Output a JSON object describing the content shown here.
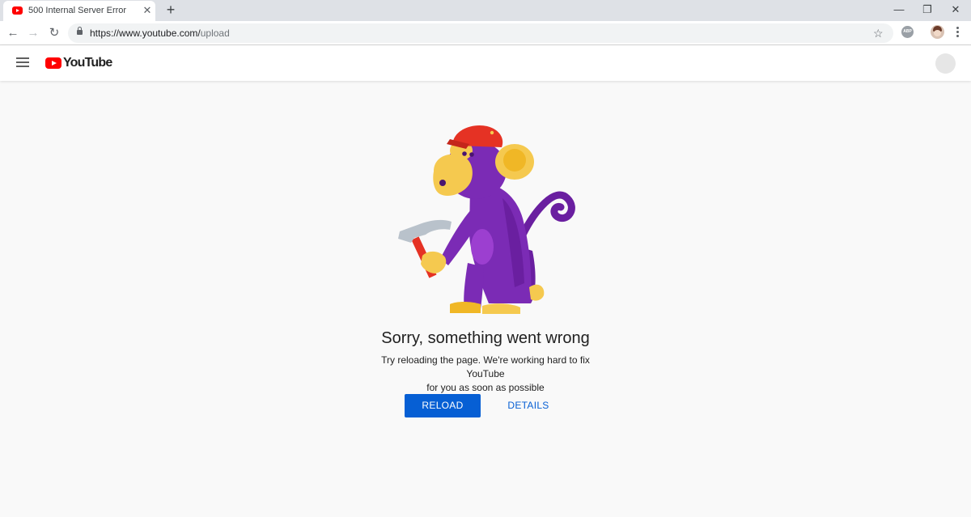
{
  "browser": {
    "tab": {
      "title": "500 Internal Server Error",
      "favicon": "youtube-favicon-icon",
      "close": "✕"
    },
    "new_tab": "+",
    "window_controls": {
      "minimize": "—",
      "maximize": "❐",
      "close": "✕"
    },
    "nav": {
      "back": "←",
      "forward": "→",
      "reload": "↻"
    },
    "address": {
      "url_host": "https://www.youtube.com/",
      "url_path": "upload"
    },
    "bookmark_star": "☆",
    "abp_label": "ABP"
  },
  "header": {
    "logo_text": "YouTube",
    "brand_color": "#ff0000"
  },
  "error": {
    "title": "Sorry, something went wrong",
    "description_line1": "Try reloading the page. We're working hard to fix YouTube",
    "description_line2": "for you as soon as possible",
    "reload_label": "RELOAD",
    "details_label": "DETAILS",
    "accent_color": "#065fd4",
    "illustration": "monkey-with-hammer"
  }
}
